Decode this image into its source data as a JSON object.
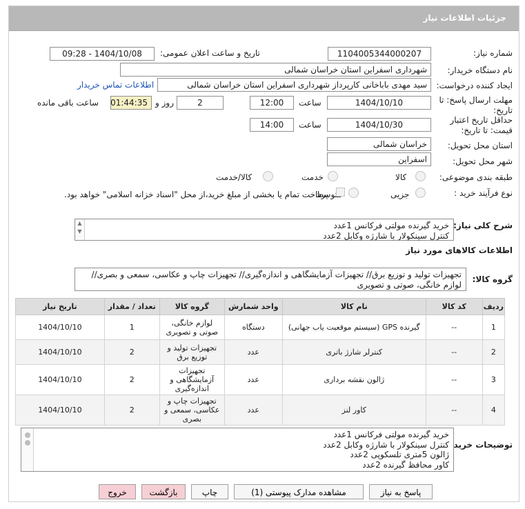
{
  "header": {
    "title": "جزئیات اطلاعات نیاز"
  },
  "form": {
    "need_number_label": "شماره نیاز:",
    "need_number": "1104005344000207",
    "announce_label": "تاریخ و ساعت اعلان عمومی:",
    "announce_value": "1404/10/08 - 09:28",
    "buyer_org_label": "نام دستگاه خریدار:",
    "buyer_org": "شهرداری اسفراین استان خراسان شمالی",
    "creator_label": "ایجاد کننده درخواست:",
    "creator": "سید مهدی  باباخانی کارپرداز   شهرداری اسفراین استان خراسان شمالی",
    "contact_link": "اطلاعات تماس خریدار",
    "reply_deadline_label_1": "مهلت ارسال پاسخ: تا",
    "reply_deadline_label_2": "تاریخ:",
    "reply_date": "1404/10/10",
    "time_label": "ساعت",
    "reply_time": "12:00",
    "days_value": "2",
    "days_label": "روز و",
    "remaining_time": "01:44:35",
    "remaining_label": "ساعت باقی مانده",
    "validity_label_1": "حداقل تاریخ اعتبار",
    "validity_label_2": "قیمت: تا تاریخ:",
    "validity_date": "1404/10/30",
    "validity_time_label": "ساعت",
    "validity_time": "14:00",
    "province_label": "استان محل تحویل:",
    "province": "خراسان شمالی",
    "city_label": "شهر محل تحویل:",
    "city": "اسفراین",
    "category_label": "طبقه بندی موضوعی:",
    "category_options": [
      "کالا",
      "خدمت",
      "کالا/خدمت"
    ],
    "process_label": "نوع فرآیند خرید :",
    "process_options": [
      "جزیی",
      "متوسط"
    ],
    "payment_note": "پرداخت تمام یا بخشی از مبلغ خرید،از محل \"اسناد خزانه اسلامی\" خواهد بود."
  },
  "summary": {
    "label": "شرح کلی نیاز:",
    "lines": [
      "خرید گیرنده مولتی فرکانس 1عدد",
      "کنترل سینکولار با شارژه وکابل 2عدد"
    ]
  },
  "goods": {
    "section_title": "اطلاعات کالاهای مورد نیاز",
    "group_label": "گروه کالا:",
    "group_lines": [
      "تجهیزات تولید و توزیع برق// تجهیزات آزمایشگاهی و اندازه‌گیری// تجهیزات چاپ و عکاسی، سمعی و بصری//",
      "لوازم خانگی، صوتی و تصویری"
    ]
  },
  "table": {
    "headers": [
      "ردیف",
      "کد کالا",
      "نام کالا",
      "واحد شمارش",
      "گروه کالا",
      "تعداد / مقدار",
      "تاریخ نیاز"
    ],
    "rows": [
      {
        "idx": "1",
        "code": "--",
        "name": "گیرنده GPS (سیستم موقعیت یاب جهانی)",
        "unit": "دستگاه",
        "group": [
          "لوازم خانگی،",
          "صوتی و تصویری"
        ],
        "qty": "1",
        "date": "1404/10/10"
      },
      {
        "idx": "2",
        "code": "--",
        "name": "کنترلر شارژ باتری",
        "unit": "عدد",
        "group": [
          "تجهیزات تولید و",
          "توزیع برق"
        ],
        "qty": "2",
        "date": "1404/10/10"
      },
      {
        "idx": "3",
        "code": "--",
        "name": "ژالون نقشه برداری",
        "unit": "عدد",
        "group": [
          "تجهیزات",
          "آزمایشگاهی و",
          "اندازه‌گیری"
        ],
        "qty": "2",
        "date": "1404/10/10"
      },
      {
        "idx": "4",
        "code": "--",
        "name": "کاور لنز",
        "unit": "عدد",
        "group": [
          "تجهیزات چاپ و",
          "عکاسی، سمعی و",
          "بصری"
        ],
        "qty": "2",
        "date": "1404/10/10"
      }
    ]
  },
  "buyer_notes": {
    "label": "توضیحات خریدار:",
    "lines": [
      "خرید گیرنده مولتی فرکانس 1عدد",
      "کنترل سینکولار با شارژه وکابل 2عدد",
      "ژالون 5متری تلسکوپی 2عدد",
      "کاور محافظ گیرنده 2عدد"
    ]
  },
  "buttons": {
    "reply": "پاسخ به نیاز",
    "attachments": "مشاهده مدارک پیوستی (1)",
    "print": "چاپ",
    "back": "بازگشت",
    "exit": "خروج"
  },
  "colors": {
    "header_bg": "#b8b8b8",
    "link": "#1d55b5",
    "remaining_bg": "#f7f1c4",
    "exit_bg": "#f6cfd4"
  }
}
